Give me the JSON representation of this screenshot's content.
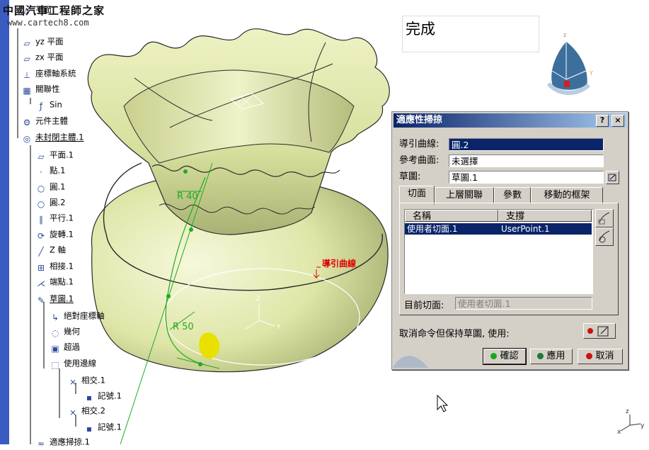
{
  "watermark": {
    "line1": "中國汽車工程師之家",
    "line2": "www.cartech8.com"
  },
  "done_label": "完成",
  "tree": {
    "items": [
      {
        "label": "平面",
        "icon": "plane-icon",
        "underline": false
      },
      {
        "label": "yz 平面",
        "icon": "plane-icon",
        "underline": false
      },
      {
        "label": "zx 平面",
        "icon": "plane-icon",
        "underline": false
      },
      {
        "label": "座標軸系統",
        "icon": "axis-system-icon",
        "underline": false
      },
      {
        "label": "關聯性",
        "icon": "relations-icon",
        "underline": false
      },
      {
        "label": "Sin",
        "icon": "formula-icon",
        "underline": false
      },
      {
        "label": "元件主體",
        "icon": "part-body-icon",
        "underline": false
      },
      {
        "label": "未封閉主體.1",
        "icon": "open-body-icon",
        "underline": true
      },
      {
        "label": "平面.1",
        "icon": "plane-icon",
        "underline": false
      },
      {
        "label": "點.1",
        "icon": "point-icon",
        "underline": false
      },
      {
        "label": "圓.1",
        "icon": "circle-icon",
        "underline": false
      },
      {
        "label": "圓.2",
        "icon": "circle-icon",
        "underline": false
      },
      {
        "label": "平行.1",
        "icon": "parallel-icon",
        "underline": false
      },
      {
        "label": "旋轉.1",
        "icon": "rotate-icon",
        "underline": false
      },
      {
        "label": "Z 軸",
        "icon": "line-icon",
        "underline": false
      },
      {
        "label": "相接.1",
        "icon": "join-icon",
        "underline": false
      },
      {
        "label": "端點.1",
        "icon": "extremum-icon",
        "underline": false
      },
      {
        "label": "草圖.1",
        "icon": "sketch-icon",
        "underline": true
      },
      {
        "label": "絕對座標軸",
        "icon": "absolute-axis-icon",
        "underline": false
      },
      {
        "label": "幾何",
        "icon": "geometry-icon",
        "underline": false
      },
      {
        "label": "超過",
        "icon": "overconstrained-icon",
        "underline": false
      },
      {
        "label": "使用邊線",
        "icon": "use-edges-icon",
        "underline": false
      },
      {
        "label": "相交.1",
        "icon": "intersect-icon",
        "underline": false
      },
      {
        "label": "記號.1",
        "icon": "mark-icon",
        "underline": false
      },
      {
        "label": "相交.2",
        "icon": "intersect-icon",
        "underline": false
      },
      {
        "label": "記號.1",
        "icon": "mark-icon",
        "underline": false
      },
      {
        "label": "適應掃掠.1",
        "icon": "sweep-icon",
        "underline": false
      }
    ]
  },
  "viewport": {
    "annotations": {
      "r40": "R 40",
      "r50": "R 50",
      "guide_label": "導引曲線"
    },
    "colors": {
      "surface": "#dfe6a8",
      "highlight": "#e8e000",
      "constraint": "#22aa22"
    }
  },
  "dialog": {
    "title": "適應性掃掠",
    "help_btn": "?",
    "close_btn": "×",
    "guide_label": "導引曲線:",
    "guide_value": "圓.2",
    "ref_label": "參考曲面:",
    "ref_value": "未選擇",
    "sketch_label": "草圖:",
    "sketch_value": "草圖.1",
    "tabs": [
      "切面",
      "上層關聯",
      "參數",
      "移動的框架"
    ],
    "list": {
      "col_name": "名稱",
      "col_support": "支撐",
      "rows": [
        {
          "name": "使用者切面.1",
          "support": "UserPoint.1"
        }
      ]
    },
    "current_label": "目前切面:",
    "current_value": "使用者切面.1",
    "cancel_keep_text": "取消命令但保持草圖, 使用:",
    "ok_label": "確認",
    "apply_label": "應用",
    "cancel_label": "取消"
  }
}
